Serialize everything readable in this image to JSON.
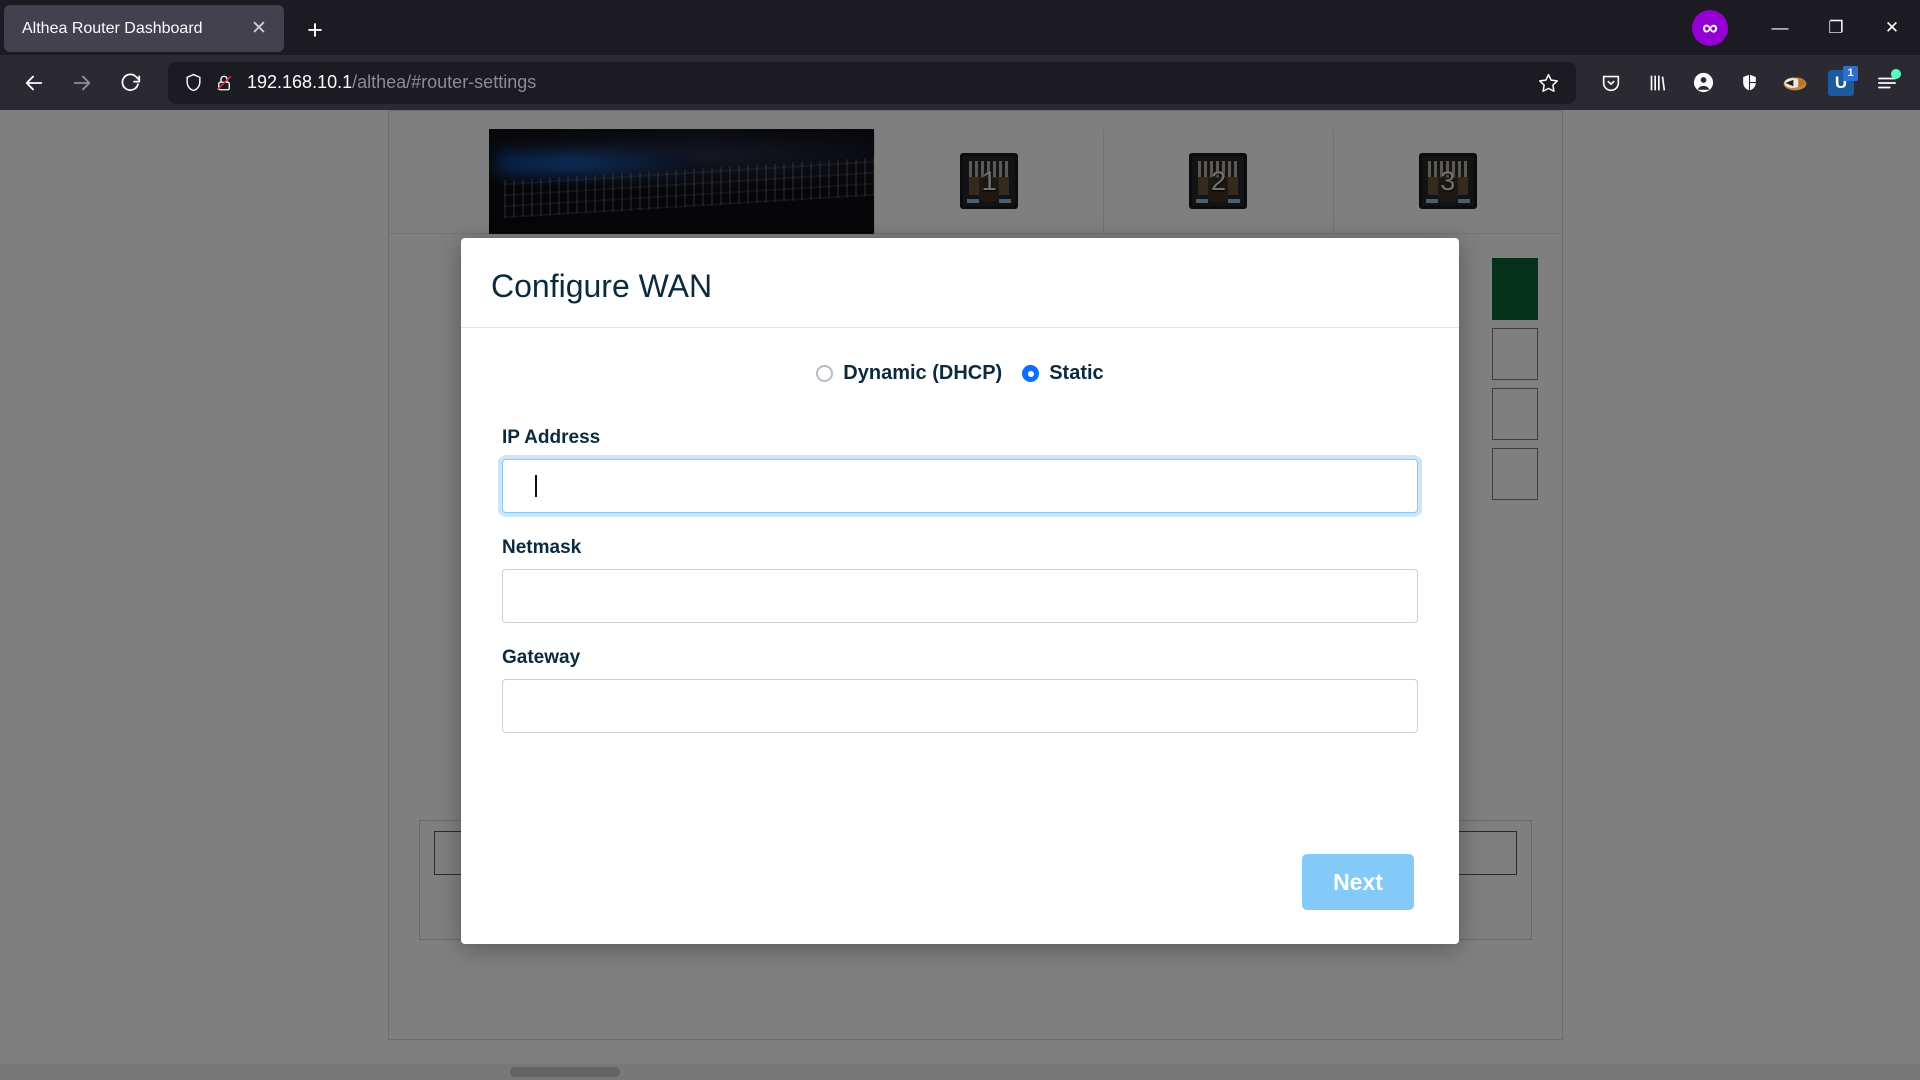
{
  "browser": {
    "tab": {
      "title": "Althea Router Dashboard",
      "close_label": "✕"
    },
    "new_tab_label": "+",
    "nav": {
      "back": "←",
      "forward": "→",
      "reload": "⟳"
    },
    "url": {
      "host": "192.168.10.1",
      "path": "/althea/#router-settings",
      "full": "192.168.10.1/althea/#router-settings"
    },
    "window_controls": {
      "minimize": "—",
      "restore": "❐",
      "close": "✕"
    },
    "private_badge": "∞",
    "toolbar_icons": [
      {
        "name": "pocket-icon",
        "glyph": "⬯"
      },
      {
        "name": "library-icon",
        "glyph": "|||\\"
      },
      {
        "name": "account-icon",
        "glyph": "●"
      },
      {
        "name": "extension-icon",
        "glyph": "◗"
      },
      {
        "name": "privacy-badger-icon",
        "glyph": "🦡"
      },
      {
        "name": "ublock-origin-icon",
        "glyph": "U",
        "badge": "1"
      },
      {
        "name": "app-menu-icon",
        "glyph": "≡"
      }
    ]
  },
  "page": {
    "hardware_ports": [
      {
        "label": "1"
      },
      {
        "label": "2"
      },
      {
        "label": "3"
      }
    ]
  },
  "modal": {
    "title": "Configure WAN",
    "mode_options": [
      {
        "label": "Dynamic (DHCP)",
        "selected": false
      },
      {
        "label": "Static",
        "selected": true
      }
    ],
    "fields": [
      {
        "label": "IP Address",
        "value": "",
        "placeholder": "",
        "focused": true
      },
      {
        "label": "Netmask",
        "value": "",
        "placeholder": "",
        "focused": false
      },
      {
        "label": "Gateway",
        "value": "",
        "placeholder": "",
        "focused": false
      }
    ],
    "next_button": {
      "label": "Next",
      "enabled": false,
      "color": "#84caf8"
    }
  },
  "colors": {
    "chrome_bg": "#1c1b22",
    "navbar_bg": "#2b2a33",
    "tab_active": "#42414d",
    "accent_blue": "#0d6efd",
    "title_navy": "#0c2a3d",
    "button_blue": "#84caf8",
    "green_status": "#0a6135",
    "overlay": "rgba(0,0,0,0.5)"
  }
}
